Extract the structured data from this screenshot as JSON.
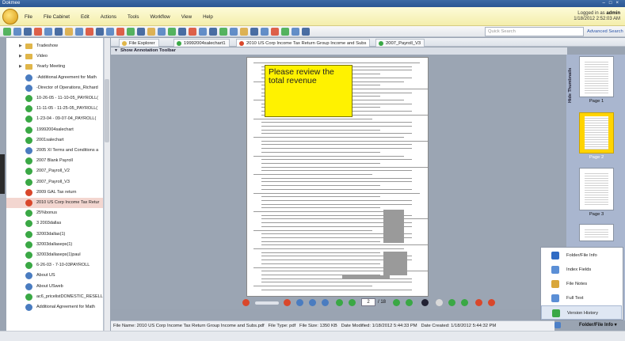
{
  "window": {
    "title": "Dokmee"
  },
  "menu": [
    "File",
    "File Cabinet",
    "Edit",
    "Actions",
    "Tools",
    "Workflow",
    "View",
    "Help"
  ],
  "login": {
    "prefix": "Logged in as ",
    "user": "admin",
    "datetime": "1/18/2012 2:52:03 AM"
  },
  "search": {
    "placeholder": "Quick Search",
    "advanced": "Advanced Search"
  },
  "tree": [
    {
      "label": "Tradeshow",
      "kind": "folder"
    },
    {
      "label": "Video",
      "kind": "folder"
    },
    {
      "label": "Yearly Meeting",
      "kind": "folder"
    },
    {
      "label": "-Additional Agreement for Math",
      "kind": "doc",
      "color": "#4a7cc0"
    },
    {
      "label": "-Director of Operations_Richard",
      "kind": "doc",
      "color": "#4a7cc0"
    },
    {
      "label": "10-26-05 - 11-10-05_PAYROLL(",
      "kind": "doc",
      "color": "#3aa845"
    },
    {
      "label": "11-11-05 - 11-25-05_PAYROLL(",
      "kind": "doc",
      "color": "#3aa845"
    },
    {
      "label": "1-23-04 - 09-07-04_PAYROLL(",
      "kind": "doc",
      "color": "#3aa845"
    },
    {
      "label": "19992004salechart",
      "kind": "doc",
      "color": "#3aa845"
    },
    {
      "label": "2001salechart",
      "kind": "doc",
      "color": "#3aa845"
    },
    {
      "label": "2005 XI Terms and Conditions a",
      "kind": "doc",
      "color": "#4a7cc0"
    },
    {
      "label": "2007 Blank Payroll",
      "kind": "doc",
      "color": "#3aa845"
    },
    {
      "label": "2007_Payroll_V2",
      "kind": "doc",
      "color": "#3aa845"
    },
    {
      "label": "2007_Payroll_V3",
      "kind": "doc",
      "color": "#3aa845"
    },
    {
      "label": "2009 GAL Tax return",
      "kind": "doc",
      "color": "#d9472b"
    },
    {
      "label": "2010 US Corp Income Tax Retur",
      "kind": "doc",
      "color": "#d9472b",
      "selected": true
    },
    {
      "label": "25%bonus",
      "kind": "doc",
      "color": "#3aa845"
    },
    {
      "label": "3 2003dallas",
      "kind": "doc",
      "color": "#3aa845"
    },
    {
      "label": "32003dallas(1)",
      "kind": "doc",
      "color": "#3aa845"
    },
    {
      "label": "32003dallaseps(1)",
      "kind": "doc",
      "color": "#3aa845"
    },
    {
      "label": "32003dallaseps(1)paul",
      "kind": "doc",
      "color": "#3aa845"
    },
    {
      "label": "6-26-03 - 7-10-03PAYROLL",
      "kind": "doc",
      "color": "#3aa845"
    },
    {
      "label": "About US",
      "kind": "doc",
      "color": "#4a7cc0"
    },
    {
      "label": "About USweb",
      "kind": "doc",
      "color": "#4a7cc0"
    },
    {
      "label": "ac6_pricelistDOMESTIC_RESELL",
      "kind": "doc",
      "color": "#3aa845"
    },
    {
      "label": "Additional Agreement for Math",
      "kind": "doc",
      "color": "#4a7cc0"
    }
  ],
  "tabs": [
    {
      "label": "File Explorer",
      "color": "#e0b64a"
    },
    {
      "label": "19992004salechart1",
      "color": "#3aa845"
    },
    {
      "label": "2010 US Corp Income Tax Return Group Income and Subs",
      "color": "#d9472b",
      "active": true
    },
    {
      "label": "2007_Payroll_V3",
      "color": "#3aa845"
    }
  ],
  "annotation_toolbar": {
    "label": "Show Annotation Toolbar"
  },
  "note": {
    "text": "Please review the total revenue"
  },
  "viewer": {
    "page_current": "2",
    "page_of": "/ 18"
  },
  "thumbnails": {
    "hide_label": "Hide Thumbnails",
    "pages": [
      "Page 1",
      "Page 2",
      "Page 3"
    ]
  },
  "popup_menu": [
    {
      "label": "Folder/File Info",
      "color": "#2f6bc4"
    },
    {
      "label": "Index Fields",
      "color": "#5b8fd6"
    },
    {
      "label": "File Notes",
      "color": "#d9a73a"
    },
    {
      "label": "Full Text",
      "color": "#5b8fd6"
    },
    {
      "label": "Version History",
      "color": "#3aa845",
      "hover": true
    }
  ],
  "folder_file_info": {
    "label": "Folder/File Info"
  },
  "status": {
    "file_name": "File Name: 2010 US Corp Income Tax Return Group  Income and Subs.pdf",
    "file_type": "File Type: pdf",
    "file_size": "File Size: 1350 KB",
    "date_modified": "Date Modified: 1/18/2012 5:44:33 PM",
    "date_created": "Date Created: 1/18/2012 5:44:32 PM"
  }
}
